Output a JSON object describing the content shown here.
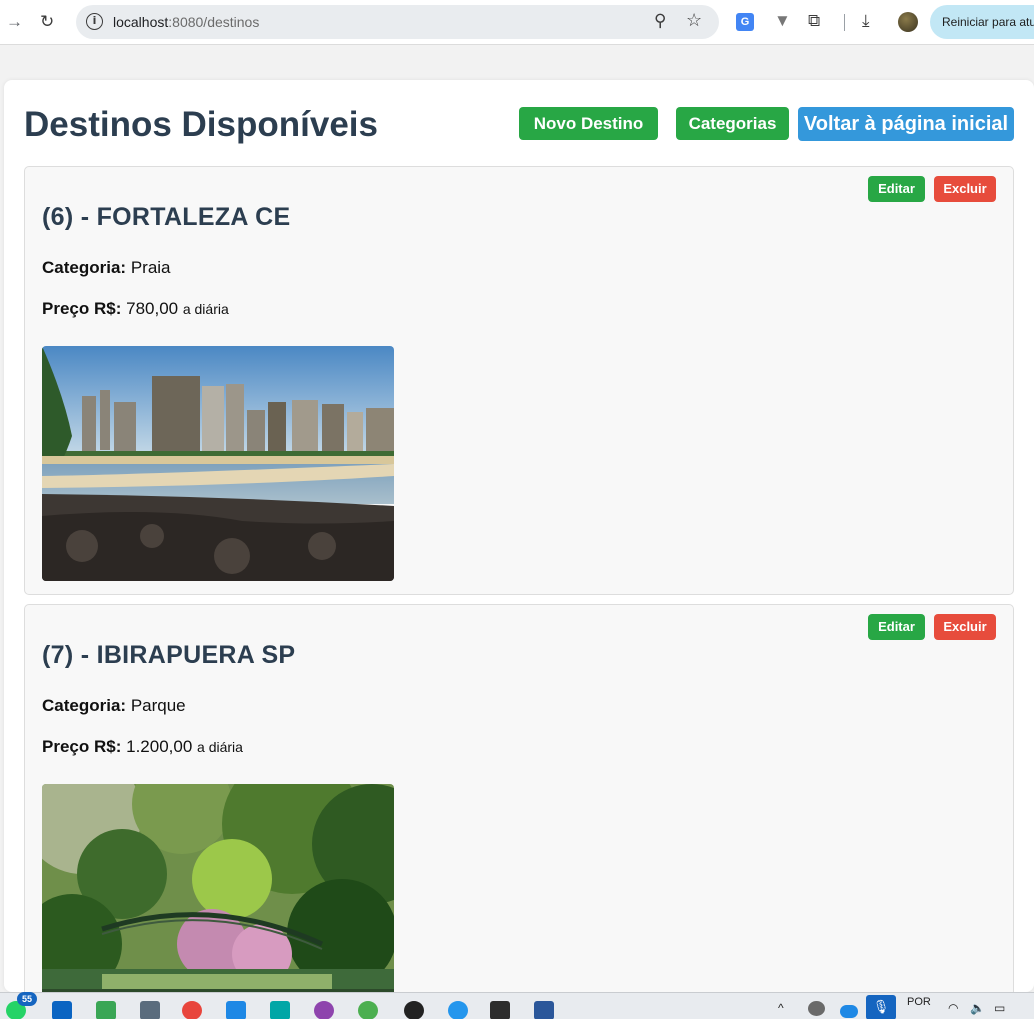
{
  "browser": {
    "url_host": "localhost",
    "url_rest": ":8080/destinos",
    "restart_label": "Reiniciar para atu"
  },
  "page": {
    "title": "Destinos Disponíveis",
    "buttons": {
      "new": "Novo Destino",
      "categories": "Categorias",
      "home": "Voltar à página inicial"
    }
  },
  "labels": {
    "category": "Categoria:",
    "price": "Preço R$:",
    "per_day": "a diária",
    "edit": "Editar",
    "delete": "Excluir"
  },
  "destinations": [
    {
      "heading": "(6) - FORTALEZA CE",
      "category": "Praia",
      "price": "780,00"
    },
    {
      "heading": "(7) - IBIRAPUERA SP",
      "category": "Parque",
      "price": "1.200,00"
    }
  ],
  "taskbar": {
    "badge_count": "55",
    "language": "POR"
  },
  "colors": {
    "green": "#28a745",
    "blue": "#3498db",
    "red": "#e74c3c",
    "title": "#2c3e50"
  }
}
